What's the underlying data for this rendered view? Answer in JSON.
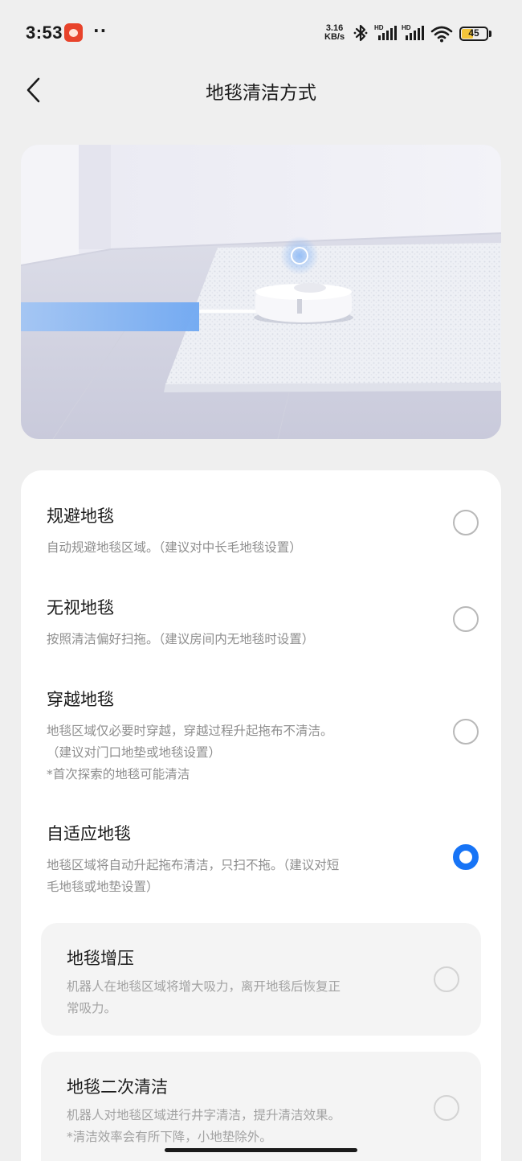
{
  "status_bar": {
    "time": "3:53",
    "dots": "··",
    "net_speed_value": "3.16",
    "net_speed_unit": "KB/s",
    "sim1_label": "HD",
    "sim2_label": "HD",
    "battery": "45",
    "battery_level": 0.45,
    "battery_color": "#f3c53a"
  },
  "header": {
    "title": "地毯清洁方式"
  },
  "options": [
    {
      "title": "规避地毯",
      "desc": [
        "自动规避地毯区域。（建议对中长毛地毯设置）"
      ],
      "selected": false
    },
    {
      "title": "无视地毯",
      "desc": [
        "按照清洁偏好扫拖。（建议房间内无地毯时设置）"
      ],
      "selected": false
    },
    {
      "title": "穿越地毯",
      "desc": [
        "地毯区域仅必要时穿越，穿越过程升起拖布不清洁。",
        "（建议对门口地垫或地毯设置）",
        "*首次探索的地毯可能清洁"
      ],
      "selected": false
    },
    {
      "title": "自适应地毯",
      "desc": [
        "地毯区域将自动升起拖布清洁，只扫不拖。（建议对短",
        "毛地毯或地垫设置）"
      ],
      "selected": true
    }
  ],
  "sub_options": [
    {
      "title": "地毯增压",
      "desc": [
        "机器人在地毯区域将增大吸力，离开地毯后恢复正",
        "常吸力。"
      ],
      "selected": false
    },
    {
      "title": "地毯二次清洁",
      "desc": [
        "机器人对地毯区域进行井字清洁，提升清洁效果。",
        "*清洁效率会有所下降，小地垫除外。"
      ],
      "selected": false
    }
  ],
  "colors": {
    "accent": "#1774f6",
    "background": "#efefef",
    "card": "#ffffff",
    "sub_card": "#f4f4f4"
  }
}
